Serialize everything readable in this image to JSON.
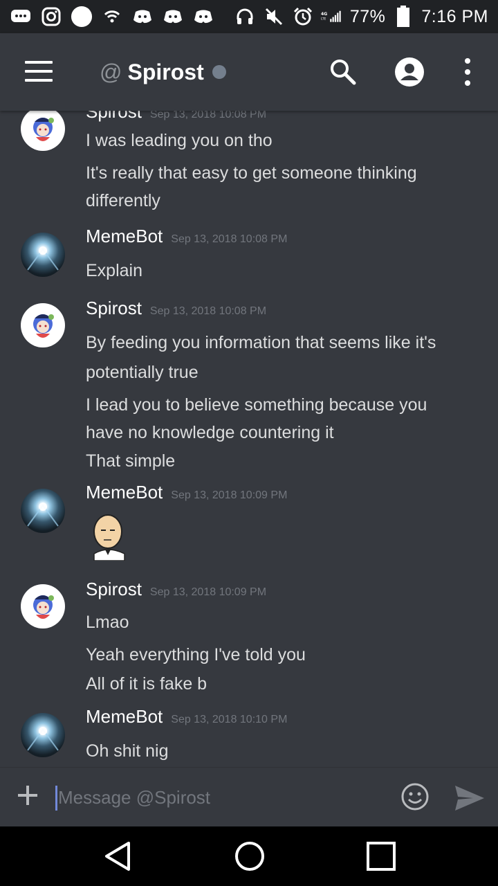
{
  "status_bar": {
    "battery": "77%",
    "time": "7:16 PM",
    "network": "4G LTE"
  },
  "header": {
    "at_symbol": "@",
    "title": "Spirost"
  },
  "messages": [
    {
      "author": "Spirost",
      "timestamp": "Sep 13, 2018 10:08 PM",
      "avatar": "spirost-avatar",
      "lines": [
        "I was leading you on tho",
        "It's really that easy to get someone thinking",
        "differently"
      ]
    },
    {
      "author": "MemeBot",
      "timestamp": "Sep 13, 2018 10:08 PM",
      "avatar": "memebot-avatar",
      "lines": [
        "Explain"
      ]
    },
    {
      "author": "Spirost",
      "timestamp": "Sep 13, 2018 10:08 PM",
      "avatar": "spirost-avatar",
      "lines": [
        "By feeding you information that seems like it's",
        "potentially true",
        "I lead you to believe something because you",
        "have no knowledge countering it",
        "That simple"
      ]
    },
    {
      "author": "MemeBot",
      "timestamp": "Sep 13, 2018 10:09 PM",
      "avatar": "memebot-avatar",
      "sticker": "bald-man-sticker"
    },
    {
      "author": "Spirost",
      "timestamp": "Sep 13, 2018 10:09 PM",
      "avatar": "spirost-avatar",
      "lines": [
        "Lmao",
        "Yeah everything I've told you",
        "All of it is fake b"
      ]
    },
    {
      "author": "MemeBot",
      "timestamp": "Sep 13, 2018 10:10 PM",
      "avatar": "memebot-avatar",
      "lines": [
        "Oh shit nig"
      ]
    }
  ],
  "composer": {
    "placeholder": "Message @Spirost"
  },
  "colors": {
    "background": "#36393f",
    "status_bar": "#202225",
    "accent": "#7289da",
    "timestamp": "#72767d",
    "offline": "#747f8d"
  }
}
